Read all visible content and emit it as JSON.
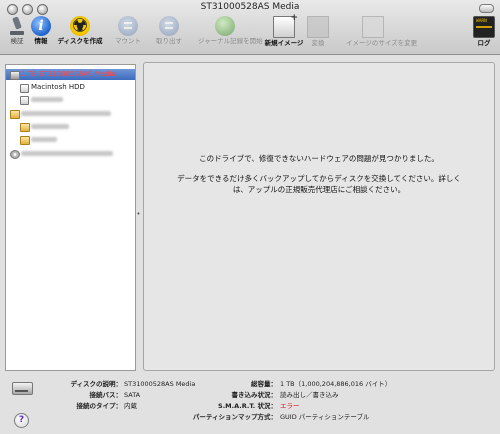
{
  "window": {
    "title": "ST31000528AS Media"
  },
  "toolbar": {
    "items": [
      {
        "label": "検証"
      },
      {
        "label": "情報"
      },
      {
        "label": "ディスクを作成"
      },
      {
        "label": "マウント"
      },
      {
        "label": "取り出す"
      },
      {
        "label": "ジャーナル記録を開始"
      },
      {
        "label": "新規イメージ"
      },
      {
        "label": "変換"
      },
      {
        "label": "イメージのサイズを変更"
      },
      {
        "label": "ログ"
      }
    ]
  },
  "sidebar": {
    "items": [
      {
        "label": "1 TB ST31000528AS Media"
      },
      {
        "label": "Macintosh HDD"
      }
    ]
  },
  "main": {
    "message_line1": "このドライブで、修復できないハードウェアの問題が見つかりました。",
    "message_line2": "データをできるだけ多くバックアップしてからディスクを交換してください。詳しく",
    "message_line3": "は、アップルの正規販売代理店にご相談ください。"
  },
  "info": {
    "desc_label": "ディスクの説明：",
    "desc_value": "ST31000528AS Media",
    "bus_label": "接続バス：",
    "bus_value": "SATA",
    "type_label": "接続のタイプ：",
    "type_value": "内蔵",
    "capacity_label": "総容量：",
    "capacity_value": "1 TB（1,000,204,886,016 バイト）",
    "rw_label": "書き込み状況：",
    "rw_value": "読み出し／書き込み",
    "smart_label": "S.M.A.R.T. 状況：",
    "smart_value": "エラー",
    "partition_label": "パーティションマップ方式：",
    "partition_value": "GUID パーティションテーブル"
  },
  "colors": {
    "error": "#e0161b",
    "selection": "#3d6cc0"
  }
}
